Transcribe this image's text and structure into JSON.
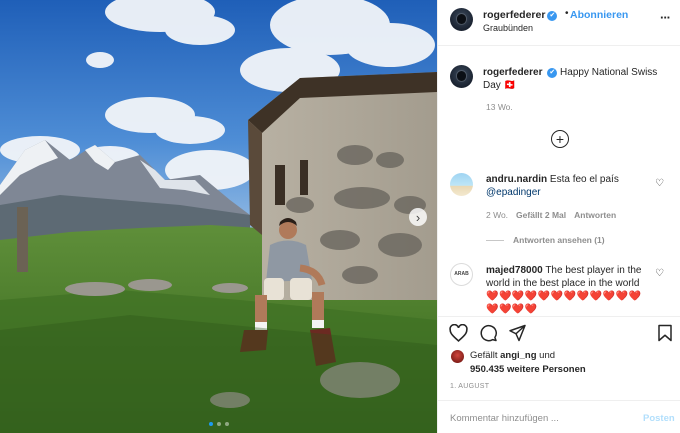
{
  "post": {
    "username": "rogerfederer",
    "verified_mark": "✔",
    "dot": "•",
    "follow_label": "Abonnieren",
    "location": "Graubünden",
    "more_label": "···",
    "caption_text": "Happy National Swiss Day",
    "caption_emoji": "🇨🇭",
    "caption_age": "13 Wo.",
    "load_more_label": "+",
    "next_label": "›"
  },
  "comments": [
    {
      "username": "andru.nardin",
      "text": "Esta feo el país",
      "mention": "@epadinger",
      "age": "2 Wo.",
      "likes": "Gefällt 2 Mal",
      "reply_label": "Antworten",
      "view_replies": "Antworten ansehen (1)"
    },
    {
      "username": "majed78000",
      "avatar_text": "ARAB",
      "text": "The best player in the world in the best place in the world",
      "hearts": "❤️❤️❤️❤️❤️❤️❤️❤️❤️❤️❤️❤️❤️❤️❤️❤️"
    }
  ],
  "likes": {
    "prefix": "Gefällt",
    "user": "angi_ng",
    "joiner": "und",
    "others": "950.435 weitere Personen"
  },
  "date": "1. AUGUST",
  "comment_box": {
    "placeholder": "Kommentar hinzufügen ...",
    "post_label": "Posten"
  },
  "colors": {
    "accent": "#3897f0",
    "heart": "#ed1c24"
  },
  "icons": [
    "heart-icon",
    "comment-icon",
    "share-icon",
    "bookmark-icon",
    "verified-icon",
    "more-icon",
    "plus-circle-icon",
    "chevron-right-icon"
  ]
}
